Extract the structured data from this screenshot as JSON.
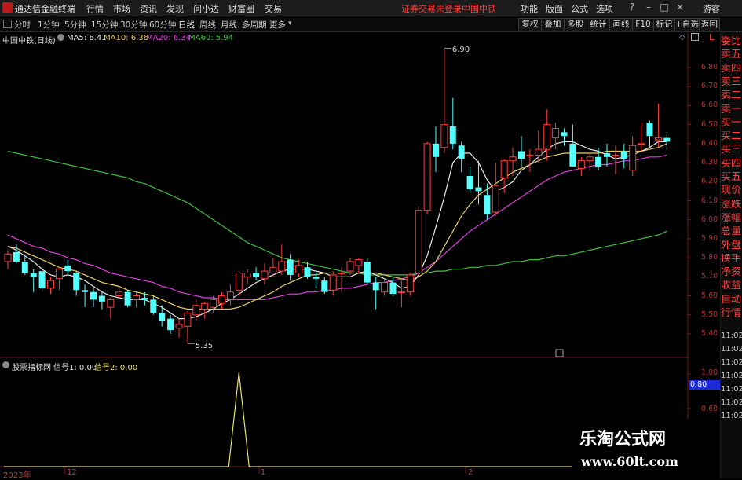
{
  "titlebar": {
    "app_name": "通达信金融终端",
    "menus": [
      "行情",
      "市场",
      "资讯",
      "发现",
      "问小达",
      "财富圈",
      "交易"
    ],
    "notice": "证券交易未登录",
    "stock": "中国中铁",
    "right_menus": [
      "功能",
      "版面",
      "公式",
      "选项"
    ],
    "guest": "游客"
  },
  "toolbar": {
    "periods": [
      "分时",
      "1分钟",
      "5分钟",
      "15分钟",
      "30分钟",
      "60分钟",
      "日线",
      "周线",
      "月线",
      "多周期",
      "更多"
    ],
    "active_period": "日线",
    "buttons": [
      "复权",
      "叠加",
      "多股",
      "统计",
      "画线",
      "F10",
      "标记",
      "+自选",
      "返回"
    ]
  },
  "main_info": {
    "title": "中国中铁(日线)",
    "ma5": "MA5: 6.41",
    "ma10": "MA10: 6.36",
    "ma20": "MA20: 6.34",
    "ma60": "MA60: 5.94",
    "high_label": "6.90",
    "low_label": "5.35",
    "right_marker": "L"
  },
  "sub_info": {
    "title": "股票指标网",
    "signal1": "信号1: 0.00",
    "signal2": "信号2: 0.00",
    "current_value": "0.80"
  },
  "colors": {
    "up": "#ff3b3b",
    "down": "#54ffff",
    "ma5": "#e8e8e8",
    "ma10": "#e8d060",
    "ma20": "#e040e0",
    "ma60": "#40c040",
    "signal": "#e8e060"
  },
  "right_panel": {
    "labels": [
      "委比",
      "卖五",
      "卖四",
      "卖三",
      "卖二",
      "卖一",
      "买一",
      "买二",
      "买三",
      "买四",
      "买五",
      "现价",
      "涨跌",
      "涨幅",
      "总量",
      "外盘",
      "换手",
      "净资",
      "收益",
      "自动",
      "行情"
    ],
    "times": [
      "11:02",
      "11:02",
      "11:02",
      "11:02",
      "11:02",
      "11:02",
      "11:02"
    ]
  },
  "price_axis": [
    "6.80",
    "6.70",
    "6.60",
    "6.50",
    "6.40",
    "6.30",
    "6.20",
    "6.10",
    "6.00",
    "5.90",
    "5.80",
    "5.70",
    "5.60",
    "5.50",
    "5.40"
  ],
  "sub_axis": [
    "1.00",
    "0.80",
    "0.60"
  ],
  "date_axis": [
    "2023年",
    "12",
    "1",
    "2"
  ],
  "watermark": {
    "line1": "乐淘公式网",
    "line2": "www.60lt.com"
  },
  "chart_data": {
    "type": "candlestick",
    "candles": [
      {
        "o": 5.78,
        "h": 5.84,
        "l": 5.74,
        "c": 5.82
      },
      {
        "o": 5.83,
        "h": 5.87,
        "l": 5.77,
        "c": 5.78
      },
      {
        "o": 5.78,
        "h": 5.81,
        "l": 5.71,
        "c": 5.72
      },
      {
        "o": 5.72,
        "h": 5.74,
        "l": 5.62,
        "c": 5.7
      },
      {
        "o": 5.73,
        "h": 5.76,
        "l": 5.62,
        "c": 5.64
      },
      {
        "o": 5.64,
        "h": 5.7,
        "l": 5.61,
        "c": 5.68
      },
      {
        "o": 5.69,
        "h": 5.75,
        "l": 5.63,
        "c": 5.74
      },
      {
        "o": 5.76,
        "h": 5.79,
        "l": 5.71,
        "c": 5.73
      },
      {
        "o": 5.72,
        "h": 5.73,
        "l": 5.6,
        "c": 5.63
      },
      {
        "o": 5.63,
        "h": 5.66,
        "l": 5.54,
        "c": 5.62
      },
      {
        "o": 5.62,
        "h": 5.64,
        "l": 5.54,
        "c": 5.58
      },
      {
        "o": 5.6,
        "h": 5.62,
        "l": 5.53,
        "c": 5.57
      },
      {
        "o": 5.54,
        "h": 5.59,
        "l": 5.48,
        "c": 5.58
      },
      {
        "o": 5.6,
        "h": 5.65,
        "l": 5.58,
        "c": 5.62
      },
      {
        "o": 5.62,
        "h": 5.63,
        "l": 5.54,
        "c": 5.55
      },
      {
        "o": 5.58,
        "h": 5.62,
        "l": 5.54,
        "c": 5.6
      },
      {
        "o": 5.59,
        "h": 5.62,
        "l": 5.55,
        "c": 5.58
      },
      {
        "o": 5.58,
        "h": 5.6,
        "l": 5.5,
        "c": 5.51
      },
      {
        "o": 5.51,
        "h": 5.55,
        "l": 5.44,
        "c": 5.47
      },
      {
        "o": 5.48,
        "h": 5.5,
        "l": 5.4,
        "c": 5.42
      },
      {
        "o": 5.43,
        "h": 5.48,
        "l": 5.38,
        "c": 5.45
      },
      {
        "o": 5.44,
        "h": 5.52,
        "l": 5.35,
        "c": 5.51
      },
      {
        "o": 5.5,
        "h": 5.58,
        "l": 5.47,
        "c": 5.55
      },
      {
        "o": 5.53,
        "h": 5.57,
        "l": 5.48,
        "c": 5.56
      },
      {
        "o": 5.54,
        "h": 5.6,
        "l": 5.51,
        "c": 5.58
      },
      {
        "o": 5.56,
        "h": 5.62,
        "l": 5.53,
        "c": 5.6
      },
      {
        "o": 5.58,
        "h": 5.66,
        "l": 5.55,
        "c": 5.62
      },
      {
        "o": 5.63,
        "h": 5.73,
        "l": 5.6,
        "c": 5.72
      },
      {
        "o": 5.7,
        "h": 5.74,
        "l": 5.66,
        "c": 5.72
      },
      {
        "o": 5.72,
        "h": 5.75,
        "l": 5.68,
        "c": 5.7
      },
      {
        "o": 5.69,
        "h": 5.77,
        "l": 5.66,
        "c": 5.73
      },
      {
        "o": 5.72,
        "h": 5.8,
        "l": 5.7,
        "c": 5.75
      },
      {
        "o": 5.73,
        "h": 5.87,
        "l": 5.71,
        "c": 5.78
      },
      {
        "o": 5.79,
        "h": 5.82,
        "l": 5.68,
        "c": 5.71
      },
      {
        "o": 5.72,
        "h": 5.79,
        "l": 5.7,
        "c": 5.76
      },
      {
        "o": 5.75,
        "h": 5.78,
        "l": 5.69,
        "c": 5.7
      },
      {
        "o": 5.7,
        "h": 5.73,
        "l": 5.64,
        "c": 5.69
      },
      {
        "o": 5.68,
        "h": 5.7,
        "l": 5.61,
        "c": 5.62
      },
      {
        "o": 5.63,
        "h": 5.73,
        "l": 5.6,
        "c": 5.71
      },
      {
        "o": 5.72,
        "h": 5.75,
        "l": 5.62,
        "c": 5.72
      },
      {
        "o": 5.73,
        "h": 5.8,
        "l": 5.71,
        "c": 5.78
      },
      {
        "o": 5.76,
        "h": 5.8,
        "l": 5.72,
        "c": 5.79
      },
      {
        "o": 5.78,
        "h": 5.8,
        "l": 5.66,
        "c": 5.67
      },
      {
        "o": 5.67,
        "h": 5.7,
        "l": 5.53,
        "c": 5.63
      },
      {
        "o": 5.62,
        "h": 5.69,
        "l": 5.6,
        "c": 5.67
      },
      {
        "o": 5.67,
        "h": 5.7,
        "l": 5.6,
        "c": 5.61
      },
      {
        "o": 5.62,
        "h": 5.68,
        "l": 5.54,
        "c": 5.62
      },
      {
        "o": 5.62,
        "h": 5.72,
        "l": 5.6,
        "c": 5.71
      },
      {
        "o": 5.72,
        "h": 6.07,
        "l": 5.7,
        "c": 6.05
      },
      {
        "o": 6.05,
        "h": 6.41,
        "l": 6.03,
        "c": 6.4
      },
      {
        "o": 6.4,
        "h": 6.49,
        "l": 6.25,
        "c": 6.33
      },
      {
        "o": 6.38,
        "h": 6.9,
        "l": 6.35,
        "c": 6.5
      },
      {
        "o": 6.49,
        "h": 6.64,
        "l": 6.37,
        "c": 6.4
      },
      {
        "o": 6.39,
        "h": 6.41,
        "l": 6.25,
        "c": 6.32
      },
      {
        "o": 6.23,
        "h": 6.28,
        "l": 6.14,
        "c": 6.16
      },
      {
        "o": 6.17,
        "h": 6.31,
        "l": 6.08,
        "c": 6.15
      },
      {
        "o": 6.13,
        "h": 6.19,
        "l": 6.0,
        "c": 6.03
      },
      {
        "o": 6.04,
        "h": 6.3,
        "l": 6.02,
        "c": 6.18
      },
      {
        "o": 6.22,
        "h": 6.32,
        "l": 6.14,
        "c": 6.31
      },
      {
        "o": 6.31,
        "h": 6.38,
        "l": 6.23,
        "c": 6.33
      },
      {
        "o": 6.36,
        "h": 6.44,
        "l": 6.28,
        "c": 6.32
      },
      {
        "o": 6.34,
        "h": 6.37,
        "l": 6.25,
        "c": 6.34
      },
      {
        "o": 6.34,
        "h": 6.47,
        "l": 6.3,
        "c": 6.37
      },
      {
        "o": 6.37,
        "h": 6.58,
        "l": 6.31,
        "c": 6.5
      },
      {
        "o": 6.43,
        "h": 6.51,
        "l": 6.37,
        "c": 6.48
      },
      {
        "o": 6.46,
        "h": 6.48,
        "l": 6.39,
        "c": 6.44
      },
      {
        "o": 6.4,
        "h": 6.5,
        "l": 6.32,
        "c": 6.28
      },
      {
        "o": 6.27,
        "h": 6.33,
        "l": 6.23,
        "c": 6.31
      },
      {
        "o": 6.31,
        "h": 6.35,
        "l": 6.26,
        "c": 6.33
      },
      {
        "o": 6.33,
        "h": 6.38,
        "l": 6.26,
        "c": 6.28
      },
      {
        "o": 6.35,
        "h": 6.4,
        "l": 6.28,
        "c": 6.33
      },
      {
        "o": 6.34,
        "h": 6.39,
        "l": 6.24,
        "c": 6.34
      },
      {
        "o": 6.36,
        "h": 6.4,
        "l": 6.27,
        "c": 6.32
      },
      {
        "o": 6.26,
        "h": 6.44,
        "l": 6.23,
        "c": 6.39
      },
      {
        "o": 6.4,
        "h": 6.51,
        "l": 6.36,
        "c": 6.4
      },
      {
        "o": 6.51,
        "h": 6.52,
        "l": 6.38,
        "c": 6.44
      },
      {
        "o": 6.42,
        "h": 6.61,
        "l": 6.38,
        "c": 6.43
      },
      {
        "o": 6.43,
        "h": 6.45,
        "l": 6.37,
        "c": 6.41
      }
    ],
    "ma5": [
      5.86,
      5.84,
      5.81,
      5.78,
      5.74,
      5.71,
      5.7,
      5.71,
      5.7,
      5.68,
      5.65,
      5.62,
      5.6,
      5.59,
      5.58,
      5.58,
      5.58,
      5.56,
      5.54,
      5.51,
      5.48,
      5.48,
      5.49,
      5.51,
      5.53,
      5.56,
      5.58,
      5.61,
      5.64,
      5.67,
      5.69,
      5.71,
      5.73,
      5.74,
      5.74,
      5.74,
      5.73,
      5.72,
      5.7,
      5.7,
      5.7,
      5.72,
      5.73,
      5.71,
      5.69,
      5.67,
      5.64,
      5.65,
      5.71,
      5.81,
      5.96,
      6.12,
      6.3,
      6.35,
      6.35,
      6.3,
      6.21,
      6.15,
      6.17,
      6.2,
      6.26,
      6.29,
      6.33,
      6.37,
      6.4,
      6.41,
      6.41,
      6.39,
      6.37,
      6.36,
      6.34,
      6.32,
      6.33,
      6.34,
      6.36,
      6.38,
      6.41,
      6.41
    ],
    "ma10": [
      5.86,
      5.85,
      5.83,
      5.81,
      5.79,
      5.77,
      5.75,
      5.74,
      5.73,
      5.71,
      5.69,
      5.67,
      5.66,
      5.65,
      5.63,
      5.62,
      5.61,
      5.6,
      5.58,
      5.56,
      5.54,
      5.53,
      5.53,
      5.53,
      5.53,
      5.53,
      5.53,
      5.54,
      5.56,
      5.58,
      5.6,
      5.62,
      5.65,
      5.67,
      5.69,
      5.71,
      5.71,
      5.72,
      5.72,
      5.72,
      5.72,
      5.72,
      5.72,
      5.72,
      5.71,
      5.7,
      5.69,
      5.68,
      5.7,
      5.73,
      5.78,
      5.86,
      5.94,
      6.02,
      6.08,
      6.13,
      6.16,
      6.19,
      6.22,
      6.25,
      6.27,
      6.29,
      6.31,
      6.33,
      6.34,
      6.35,
      6.35,
      6.35,
      6.35,
      6.35,
      6.36,
      6.36,
      6.36,
      6.36,
      6.36,
      6.37,
      6.38,
      6.4
    ],
    "ma20": [
      5.92,
      5.9,
      5.88,
      5.86,
      5.85,
      5.83,
      5.82,
      5.8,
      5.79,
      5.77,
      5.76,
      5.74,
      5.72,
      5.71,
      5.7,
      5.69,
      5.68,
      5.67,
      5.65,
      5.64,
      5.62,
      5.61,
      5.6,
      5.59,
      5.59,
      5.58,
      5.58,
      5.58,
      5.58,
      5.58,
      5.58,
      5.59,
      5.6,
      5.61,
      5.61,
      5.62,
      5.62,
      5.63,
      5.63,
      5.64,
      5.64,
      5.65,
      5.66,
      5.67,
      5.67,
      5.68,
      5.69,
      5.7,
      5.72,
      5.75,
      5.78,
      5.82,
      5.86,
      5.9,
      5.94,
      5.97,
      6.0,
      6.03,
      6.06,
      6.09,
      6.12,
      6.15,
      6.18,
      6.21,
      6.23,
      6.25,
      6.26,
      6.27,
      6.28,
      6.29,
      6.29,
      6.3,
      6.31,
      6.31,
      6.32,
      6.33,
      6.33,
      6.34
    ],
    "ma60": [
      6.36,
      6.35,
      6.34,
      6.33,
      6.32,
      6.31,
      6.3,
      6.29,
      6.28,
      6.27,
      6.26,
      6.25,
      6.24,
      6.23,
      6.22,
      6.2,
      6.19,
      6.17,
      6.15,
      6.13,
      6.11,
      6.09,
      6.06,
      6.03,
      6.0,
      5.97,
      5.94,
      5.91,
      5.88,
      5.86,
      5.84,
      5.82,
      5.8,
      5.79,
      5.78,
      5.77,
      5.76,
      5.75,
      5.74,
      5.73,
      5.72,
      5.72,
      5.71,
      5.71,
      5.71,
      5.71,
      5.71,
      5.71,
      5.72,
      5.72,
      5.73,
      5.73,
      5.74,
      5.74,
      5.75,
      5.75,
      5.76,
      5.76,
      5.77,
      5.78,
      5.78,
      5.79,
      5.79,
      5.8,
      5.81,
      5.81,
      5.82,
      5.83,
      5.84,
      5.85,
      5.86,
      5.87,
      5.88,
      5.89,
      5.9,
      5.91,
      5.92,
      5.94
    ],
    "signal_spike_index": 27,
    "signal_values_note": "0 except spike at index 27 reaching 1.00",
    "ylim": [
      5.33,
      6.95
    ]
  }
}
